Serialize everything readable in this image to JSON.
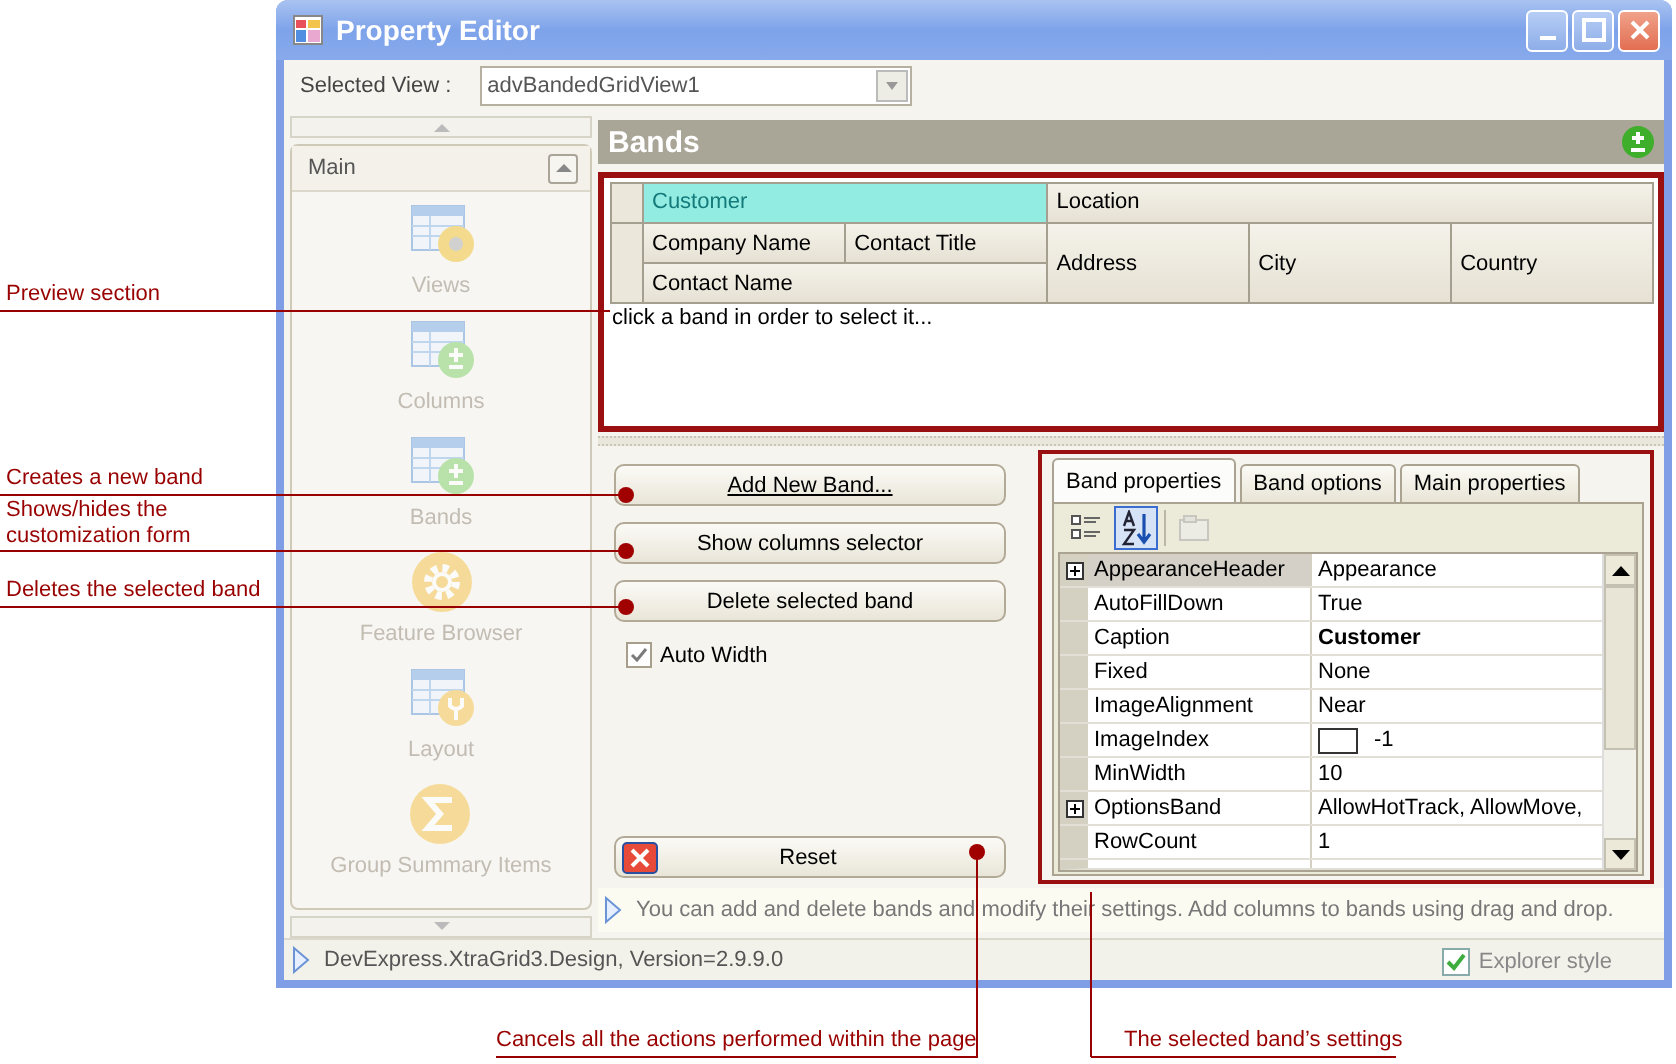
{
  "window": {
    "title": "Property Editor"
  },
  "selected_view": {
    "label": "Selected View :",
    "value": "advBandedGridView1"
  },
  "navigation": {
    "group": "Main",
    "items": [
      {
        "label": "Views",
        "kind": "views"
      },
      {
        "label": "Columns",
        "kind": "columns"
      },
      {
        "label": "Bands",
        "kind": "bands"
      },
      {
        "label": "Feature Browser",
        "kind": "features"
      },
      {
        "label": "Layout",
        "kind": "layout"
      },
      {
        "label": "Group Summary Items",
        "kind": "summary"
      }
    ]
  },
  "page": {
    "title": "Bands"
  },
  "preview": {
    "bands": [
      {
        "caption": "Customer",
        "selected": true,
        "rows": [
          [
            "Company Name",
            "Contact Title"
          ],
          [
            "Contact Name"
          ]
        ]
      },
      {
        "caption": "Location",
        "selected": false,
        "rows": [
          [
            "Address",
            "City",
            "Country"
          ]
        ]
      }
    ],
    "message": "click a band in order to select it..."
  },
  "actions": [
    {
      "label": "Add New Band...",
      "focused": true
    },
    {
      "label": "Show columns selector",
      "focused": false
    },
    {
      "label": "Delete selected band",
      "focused": false
    }
  ],
  "auto_width": {
    "label": "Auto Width",
    "checked": true
  },
  "reset": {
    "label": "Reset"
  },
  "properties": {
    "tabs": [
      {
        "label": "Band properties",
        "selected": true
      },
      {
        "label": "Band options",
        "selected": false
      },
      {
        "label": "Main properties",
        "selected": false
      }
    ],
    "toolbar": [
      {
        "kind": "categorized",
        "selected": false,
        "disabled": false
      },
      {
        "kind": "alphabetical",
        "selected": true,
        "disabled": false
      },
      {
        "kind": "pages",
        "selected": false,
        "disabled": true
      }
    ],
    "rows": [
      {
        "name": "AppearanceHeader",
        "value": "Appearance",
        "expandable": true,
        "selected": true,
        "modified": false
      },
      {
        "name": "AutoFillDown",
        "value": "True",
        "expandable": false,
        "selected": false,
        "modified": false
      },
      {
        "name": "Caption",
        "value": "Customer",
        "expandable": false,
        "selected": false,
        "modified": true
      },
      {
        "name": "Fixed",
        "value": "None",
        "expandable": false,
        "selected": false,
        "modified": false
      },
      {
        "name": "ImageAlignment",
        "value": "Near",
        "expandable": false,
        "selected": false,
        "modified": false
      },
      {
        "name": "ImageIndex",
        "value": "-1",
        "kind": "image",
        "expandable": false,
        "selected": false,
        "modified": false
      },
      {
        "name": "MinWidth",
        "value": "10",
        "expandable": false,
        "selected": false,
        "modified": false
      },
      {
        "name": "OptionsBand",
        "value": "AllowHotTrack, AllowMove,",
        "expandable": true,
        "selected": false,
        "modified": false
      },
      {
        "name": "RowCount",
        "value": "1",
        "expandable": false,
        "selected": false,
        "modified": false
      }
    ]
  },
  "hint": "You can add and delete bands and modify their settings. Add columns to bands using drag and drop.",
  "status_bar": {
    "text": "DevExpress.XtraGrid3.Design, Version=2.9.9.0",
    "explorer_style": {
      "label": "Explorer style",
      "checked": true
    }
  },
  "annotations": [
    {
      "text": "Preview section"
    },
    {
      "text": "Creates a new band"
    },
    {
      "text": "Shows/hides the customization form"
    },
    {
      "text": "Deletes the selected band"
    },
    {
      "text": "Cancels all the actions performed within the page"
    },
    {
      "text": "The selected band’s settings"
    }
  ]
}
